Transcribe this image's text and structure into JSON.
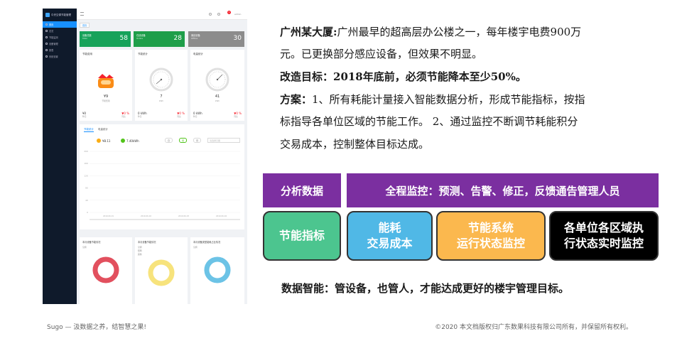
{
  "dashboard": {
    "app_title": "中央空调节能管理",
    "sidebar_items": [
      "首页",
      "总览",
      "节能监测",
      "设备管理",
      "报表",
      "系统设置"
    ],
    "topbar_badge": "1",
    "topbar_user": "admin",
    "breadcrumb": "首页",
    "kpi": [
      {
        "label": "设备总数",
        "sub": "Total",
        "value": "58",
        "color": "#16a25a"
      },
      {
        "label": "在线设备",
        "sub": "Online",
        "value": "28",
        "color": "#1e9e4a"
      },
      {
        "label": "离线设备",
        "sub": "Offline",
        "value": "30",
        "color": "#8c8c8c"
      }
    ],
    "gauges": [
      {
        "title": "节能费用",
        "center_value": "¥9",
        "center_label": "节能费用",
        "foot_left": "¥0",
        "foot_right": "▼0 %",
        "foot_left_label": "昨日",
        "foot_right_label": "同比"
      },
      {
        "title": "节能统计",
        "center_value": "7",
        "center_label": "kWh",
        "foot_left": "0 kWh",
        "foot_right": "▼0 %",
        "foot_left_label": "昨日",
        "foot_right_label": "同比"
      },
      {
        "title": "电量统计",
        "center_value": "41",
        "center_label": "kWh",
        "foot_left": "0 kWh",
        "foot_right": "▼0 %",
        "foot_left_label": "昨日",
        "foot_right_label": "同比"
      }
    ],
    "chart_tabs": [
      "节能统计",
      "电量统计"
    ],
    "chart_values": [
      "¥8.11",
      "7.40kWh"
    ],
    "period_buttons": [
      "日",
      "周",
      "月"
    ],
    "period_select": "请选择日期",
    "chart_y_ticks": [
      "200",
      "160",
      "120",
      "80",
      "40",
      "0"
    ],
    "chart_x_ticks": [
      "2019-06-01",
      "2019-06-02",
      "2019-06-03",
      "2019-06-04"
    ],
    "donuts": [
      {
        "title": "本月设备节能情况",
        "legend": [
          "空调"
        ],
        "color": "#e2505e"
      },
      {
        "title": "本月设备节能情况",
        "legend": [
          "空调",
          "照明",
          "其他"
        ],
        "color": "#f7e37c"
      },
      {
        "title": "本月设备类型能耗占比情况",
        "legend": [
          "空调"
        ],
        "color": "#6cc3e6"
      }
    ]
  },
  "content": {
    "p1_head": "广州某大厦:",
    "p1_line1": "广州最早的超高层办公楼之一，每年楼宇电费900万",
    "p1_line2": "元。已更换部分感应设备，但效果不明显。",
    "p2": "改造目标：2018年底前，必须节能降本至少50%。",
    "p3_head": "方案：",
    "p3_line1": "1、所有耗能计量接入智能数据分析，形成节能指标，按指",
    "p3_line2": "标指导各单位区域的节能工作。 2、通过监控不断调节耗能积分",
    "p3_line3": "交易成本，控制整体目标达成。",
    "purple_left": "分析数据",
    "purple_right": "全程监控：预测、告警、修正，反馈通告管理人员",
    "boxes": [
      {
        "line1": "节能指标",
        "line2": "",
        "bg": "#4cc58f",
        "fg": "#ffffff"
      },
      {
        "line1": "能耗",
        "line2": "交易成本",
        "bg": "#50b8e6",
        "fg": "#ffffff"
      },
      {
        "line1": "节能系统",
        "line2": "运行状态监控",
        "bg": "#fbb84e",
        "fg": "#ffffff"
      },
      {
        "line1": "各单位各区域执",
        "line2": "行状态实时监控",
        "bg": "#000000",
        "fg": "#ffffff"
      }
    ],
    "conclusion": "数据智能：管设备，也管人，才能达成更好的楼宇管理目标。"
  },
  "footer": {
    "left": "Sugo — 汲数据之养，结智慧之果!",
    "right": "©2020 本文档版权归广东数果科技有限公司所有，并保留所有权利。"
  }
}
